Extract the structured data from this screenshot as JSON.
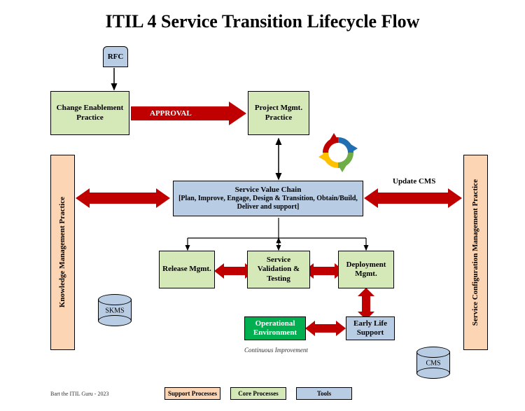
{
  "title": "ITIL 4 Service Transition Lifecycle Flow",
  "rfc": "RFC",
  "changeEnablement": "Change Enablement Practice",
  "approval": "APPROVAL",
  "projectMgmt": "Project Mgmt. Practice",
  "updateCms": "Update CMS",
  "svc": {
    "line1": "Service Value Chain",
    "line2": "[Plan, Improve, Engage, Design & Transition, Obtain/Build, Deliver and support]"
  },
  "km": "Knowledge Management Practice",
  "scm": "Service Configuration Management Practice",
  "release": "Release Mgmt.",
  "svt": "Service Validation & Testing",
  "deploy": "Deployment Mgmt.",
  "opEnv": "Operational Environment",
  "earlyLife": "Early Life Support",
  "skms": "SKMS",
  "cms": "CMS",
  "continuous": "Continuous Improvement",
  "credit": "Bart the ITIL Guru - 2023",
  "legend": {
    "support": "Support Processes",
    "core": "Core Processes",
    "tools": "Tools"
  },
  "colors": {
    "arrowRed": "#c00000",
    "arrowBlack": "#000000"
  }
}
